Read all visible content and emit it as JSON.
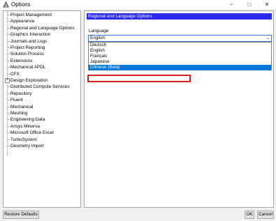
{
  "window": {
    "title": "Options",
    "minimize": "–",
    "maximize": "□",
    "close": "✕"
  },
  "tree": {
    "items": [
      {
        "label": "Project Management"
      },
      {
        "label": "Appearance"
      },
      {
        "label": "Regional and Language Options"
      },
      {
        "label": "Graphics Interaction"
      },
      {
        "label": "Journals and Logs"
      },
      {
        "label": "Project Reporting"
      },
      {
        "label": "Solution Process"
      },
      {
        "label": "Extensions"
      },
      {
        "label": "Mechanical APDL"
      },
      {
        "label": "CFX"
      },
      {
        "label": "Design Exploration",
        "expander": "+"
      },
      {
        "label": "Distributed Compute Services"
      },
      {
        "label": "Repository"
      },
      {
        "label": "Fluent"
      },
      {
        "label": "Mechanical"
      },
      {
        "label": "Meshing"
      },
      {
        "label": "Engineering Data"
      },
      {
        "label": "Ansys Minerva"
      },
      {
        "label": "Microsoft Office Excel"
      },
      {
        "label": "TurboSystem"
      },
      {
        "label": "Geometry Import"
      }
    ]
  },
  "main": {
    "section_title": "Regional and Language Options",
    "language_label": "Language",
    "language_value": "English",
    "language_options": [
      "Deutsch",
      "English",
      "Français",
      "Japanese",
      "Chinese (Beta)"
    ],
    "selected_option": "Chinese (Beta)"
  },
  "footer": {
    "restore_label": "Restore Defaults",
    "ok_label": "OK",
    "cancel_label": "Cancel"
  },
  "colors": {
    "section_header": "#2b2bf0",
    "selection": "#0078d7",
    "annotation": "#d42020"
  }
}
